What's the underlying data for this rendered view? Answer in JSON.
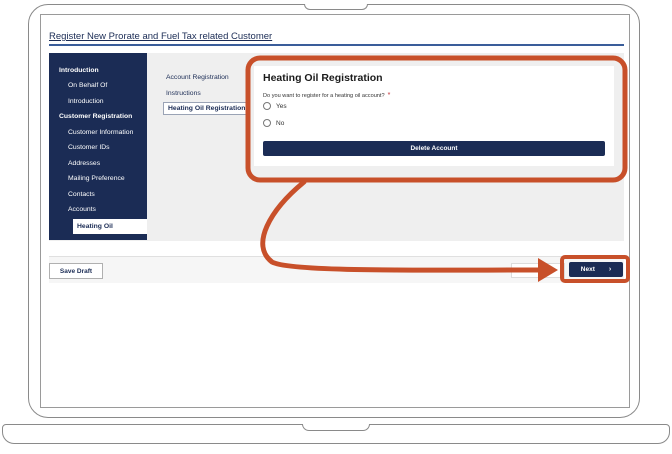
{
  "page": {
    "title": "Register New Prorate and Fuel Tax related Customer"
  },
  "sidebar": {
    "items": [
      {
        "label": "Introduction",
        "kind": "section"
      },
      {
        "label": "On Behalf Of",
        "kind": "sub"
      },
      {
        "label": "Introduction",
        "kind": "sub"
      },
      {
        "label": "Customer Registration",
        "kind": "section"
      },
      {
        "label": "Customer Information",
        "kind": "sub"
      },
      {
        "label": "Customer IDs",
        "kind": "sub"
      },
      {
        "label": "Addresses",
        "kind": "sub"
      },
      {
        "label": "Mailing Preference",
        "kind": "sub"
      },
      {
        "label": "Contacts",
        "kind": "sub"
      },
      {
        "label": "Accounts",
        "kind": "sub"
      },
      {
        "label": "Heating Oil",
        "kind": "active"
      }
    ]
  },
  "steps": [
    {
      "label": "Account Registration"
    },
    {
      "label": "Instructions"
    },
    {
      "label": "Heating Oil Registration",
      "active": true
    }
  ],
  "form": {
    "title": "Heating Oil Registration",
    "question": "Do you want to register for a heating oil account?",
    "required_mark": "*",
    "options": [
      {
        "label": "Yes",
        "selected": false
      },
      {
        "label": "No",
        "selected": false
      }
    ],
    "delete_label": "Delete Account"
  },
  "footer": {
    "save_draft_label": "Save Draft",
    "next_label": "Next",
    "next_icon": "chevron-right-icon"
  },
  "colors": {
    "navy": "#1b2c55",
    "annotation_orange": "#c8502a",
    "required_red": "#c0282d"
  }
}
